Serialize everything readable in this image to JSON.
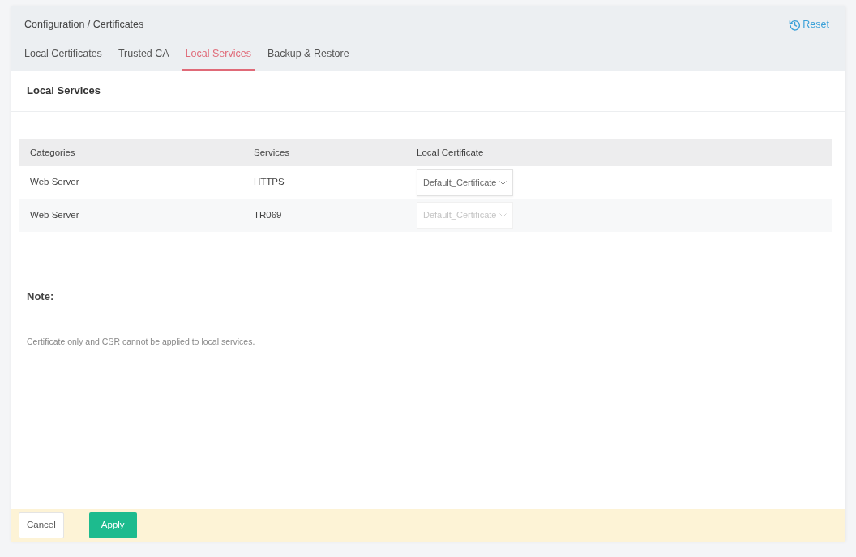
{
  "breadcrumb": "Configuration / Certificates",
  "reset": {
    "label": "Reset"
  },
  "tabs": [
    {
      "label": "Local Certificates",
      "selected": false
    },
    {
      "label": "Trusted CA",
      "selected": false
    },
    {
      "label": "Local Services",
      "selected": true
    },
    {
      "label": "Backup & Restore",
      "selected": false
    }
  ],
  "panel": {
    "title": "Local Services",
    "table": {
      "columns": [
        "Categories",
        "Services",
        "Local Certificate"
      ],
      "rows": [
        {
          "category": "Web Server",
          "service": "HTTPS",
          "certificate": {
            "value": "Default_Certificate",
            "disabled": false
          }
        },
        {
          "category": "Web Server",
          "service": "TR069",
          "certificate": {
            "value": "Default_Certificate",
            "disabled": true
          }
        }
      ]
    },
    "note": {
      "title": "Note:",
      "text": "Certificate only and CSR cannot be applied to local services."
    }
  },
  "buttons": [
    {
      "label": "Cancel",
      "kind": "secondary"
    },
    {
      "label": "Apply",
      "kind": "primary"
    }
  ]
}
